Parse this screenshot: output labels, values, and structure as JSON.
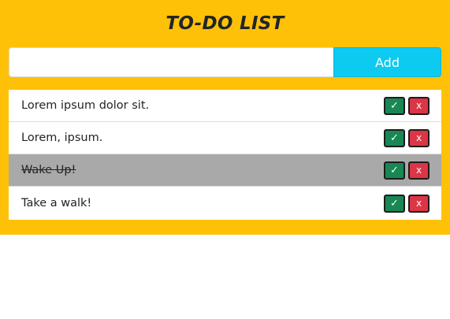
{
  "header": {
    "title": "TO-DO LIST"
  },
  "form": {
    "input_value": "",
    "input_placeholder": "",
    "add_label": "Add"
  },
  "todos": [
    {
      "text": "Lorem ipsum dolor sit.",
      "done": false,
      "check_label": "✓",
      "delete_label": "x"
    },
    {
      "text": "Lorem, ipsum.",
      "done": false,
      "check_label": "✓",
      "delete_label": "x"
    },
    {
      "text": "Wake Up!",
      "done": true,
      "check_label": "✓",
      "delete_label": "x"
    },
    {
      "text": "Take a walk!",
      "done": false,
      "check_label": "✓",
      "delete_label": "x"
    }
  ],
  "colors": {
    "background": "#ffc107",
    "add_button": "#0dcaf0",
    "check_button": "#198754",
    "delete_button": "#dc3545",
    "done_row": "#a9a9a9"
  }
}
